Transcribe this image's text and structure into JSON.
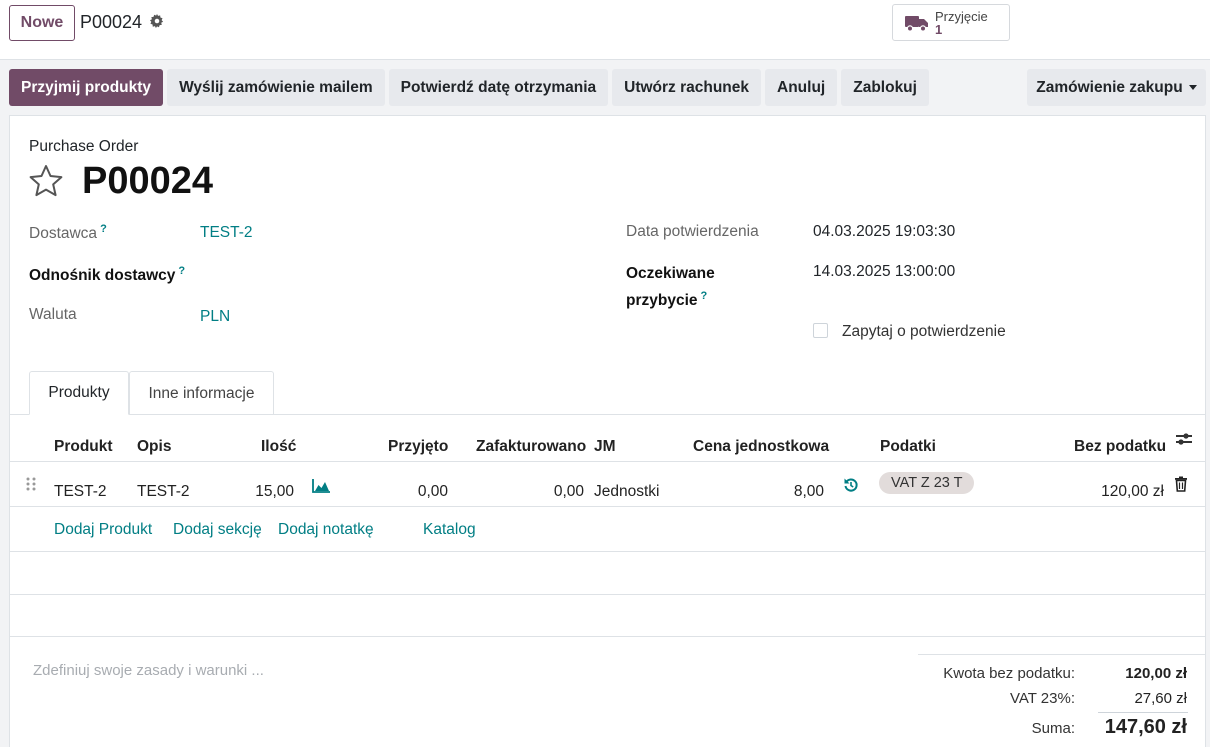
{
  "header": {
    "new_button": "Nowe",
    "breadcrumb_title": "P00024",
    "receipt_label": "Przyjęcie",
    "receipt_count": "1"
  },
  "actions": {
    "receive": "Przyjmij produkty",
    "send_email": "Wyślij zamówienie mailem",
    "confirm_date": "Potwierdź datę otrzymania",
    "create_bill": "Utwórz rachunek",
    "cancel": "Anuluj",
    "lock": "Zablokuj",
    "status": "Zamówienie zakupu"
  },
  "form": {
    "doc_type": "Purchase Order",
    "name": "P00024",
    "vendor_label": "Dostawca",
    "vendor_value": "TEST-2",
    "vendor_ref_label": "Odnośnik dostawcy",
    "currency_label": "Waluta",
    "currency_value": "PLN",
    "confirm_date_label": "Data potwierdzenia",
    "confirm_date_value": "04.03.2025 19:03:30",
    "expected_label_1": "Oczekiwane",
    "expected_label_2": "przybycie",
    "expected_value": "14.03.2025 13:00:00",
    "ask_confirmation": "Zapytaj o potwierdzenie",
    "help_mark": "?"
  },
  "tabs": [
    "Produkty",
    "Inne informacje"
  ],
  "table": {
    "headers": {
      "product": "Produkt",
      "description": "Opis",
      "qty": "Ilość",
      "received": "Przyjęto",
      "invoiced": "Zafakturowano",
      "uom": "JM",
      "unit_price": "Cena jednostkowa",
      "taxes": "Podatki",
      "subtotal": "Bez podatku"
    },
    "rows": [
      {
        "product": "TEST-2",
        "description": "TEST-2",
        "qty": "15,00",
        "received": "0,00",
        "invoiced": "0,00",
        "uom": "Jednostki",
        "unit_price": "8,00",
        "tax": "VAT Z 23 T",
        "subtotal": "120,00 zł"
      }
    ],
    "add_product": "Dodaj Produkt",
    "add_section": "Dodaj sekcję",
    "add_note": "Dodaj notatkę",
    "catalog": "Katalog"
  },
  "footer": {
    "terms_placeholder": "Zdefiniuj swoje zasady i warunki ...",
    "untaxed_label": "Kwota bez podatku:",
    "untaxed_value": "120,00 zł",
    "vat_label": "VAT 23%:",
    "vat_value": "27,60 zł",
    "total_label": "Suma:",
    "total_value": "147,60 zł"
  },
  "colors": {
    "primary": "#714b67",
    "link": "#017e84"
  }
}
